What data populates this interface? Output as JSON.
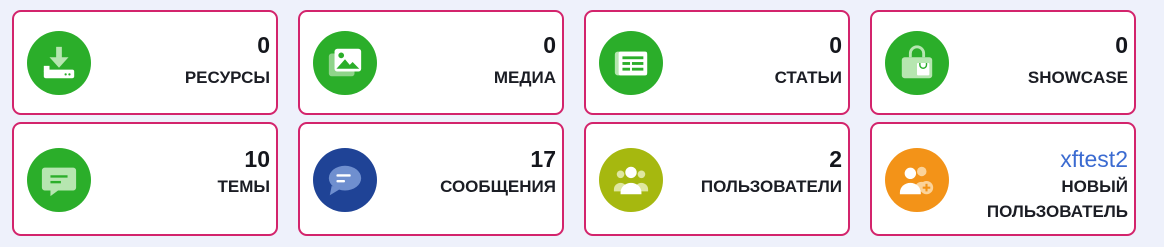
{
  "stats": [
    {
      "value": "0",
      "label": "РЕСУРСЫ",
      "icon": "download-tray-icon",
      "color": "#2bae2a"
    },
    {
      "value": "0",
      "label": "МЕДИА",
      "icon": "image-gallery-icon",
      "color": "#2bae2a"
    },
    {
      "value": "0",
      "label": "СТАТЬИ",
      "icon": "newspaper-icon",
      "color": "#2bae2a"
    },
    {
      "value": "0",
      "label": "SHOWCASE",
      "icon": "shopping-bag-icon",
      "color": "#2bae2a"
    },
    {
      "value": "10",
      "label": "ТЕМЫ",
      "icon": "speech-bubble-icon",
      "color": "#2bae2a"
    },
    {
      "value": "17",
      "label": "СООБЩЕНИЯ",
      "icon": "chat-bubble-icon",
      "color": "#1f4396"
    },
    {
      "value": "2",
      "label": "ПОЛЬЗОВАТЕЛИ",
      "icon": "users-group-icon",
      "color": "#a6b80f"
    },
    {
      "value": "xftest2",
      "label": "НОВЫЙ ПОЛЬЗОВАТЕЛЬ",
      "icon": "user-add-icon",
      "color": "#f39318"
    }
  ]
}
